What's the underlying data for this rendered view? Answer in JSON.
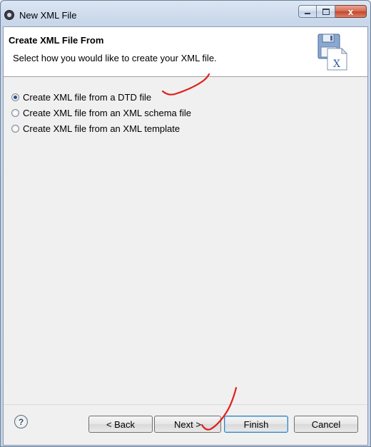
{
  "window": {
    "title": "New XML File",
    "close_glyph": "x",
    "app_icon": "eclipse-icon"
  },
  "header": {
    "title": "Create XML File From",
    "subtitle": "Select how you would like to create your XML file.",
    "icon": "xml-wizard-icon",
    "icon_letter": "X"
  },
  "options": [
    {
      "label": "Create XML file from a DTD file",
      "checked": true
    },
    {
      "label": "Create XML file from an XML schema file",
      "checked": false
    },
    {
      "label": "Create XML file from an XML template",
      "checked": false
    }
  ],
  "footer": {
    "help_glyph": "?",
    "back_label": "< Back",
    "next_label": "Next >",
    "finish_label": "Finish",
    "cancel_label": "Cancel"
  },
  "colors": {
    "annotation": "#e0201b",
    "radio_dot": "#2a4f86"
  }
}
